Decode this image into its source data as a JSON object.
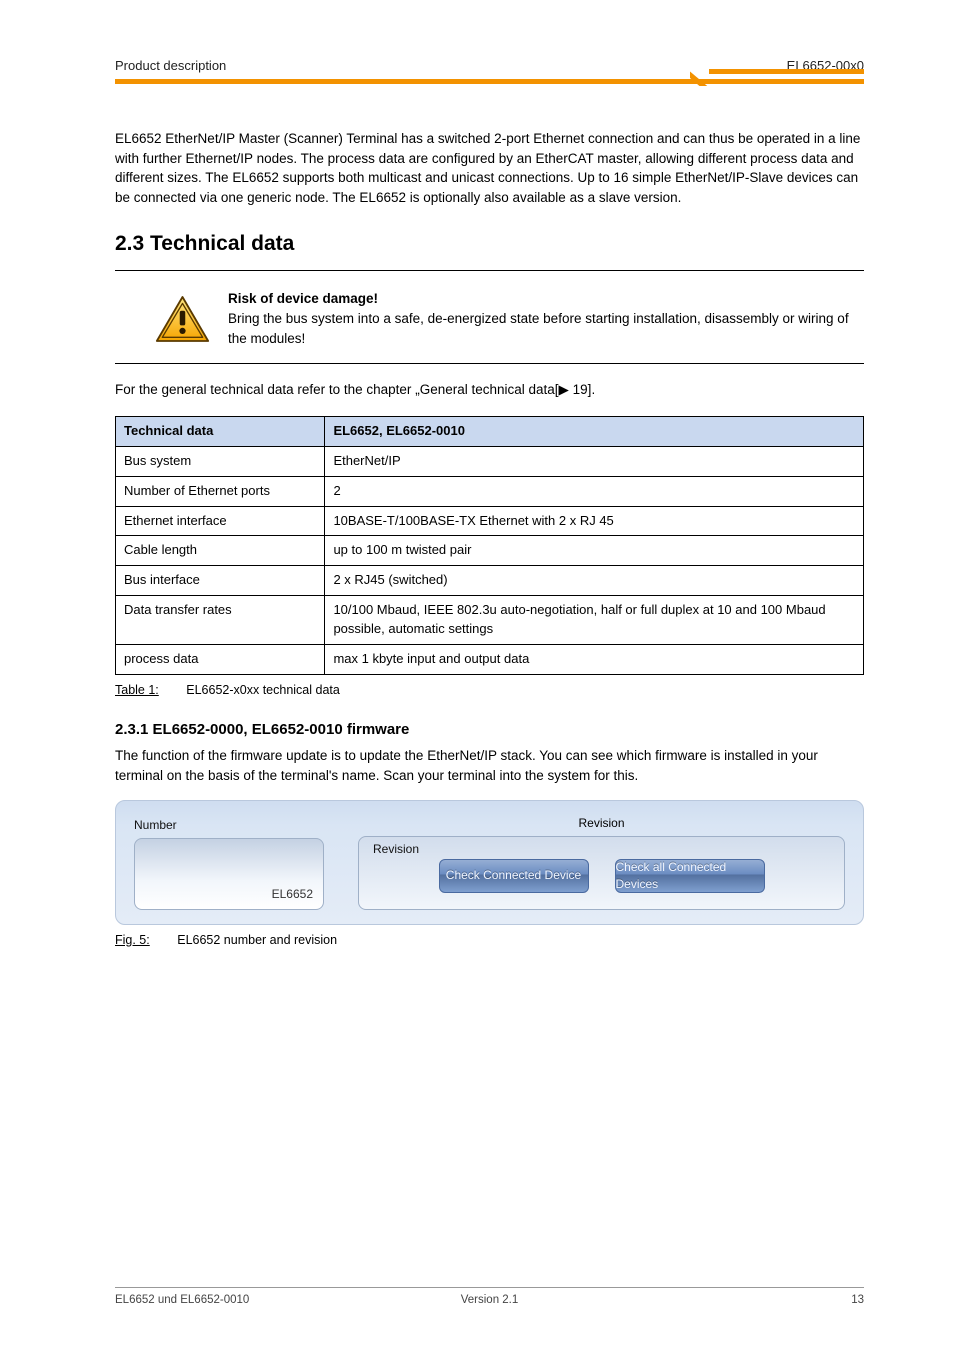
{
  "header": {
    "left": "Product description",
    "right": "EL6652-00x0"
  },
  "p1": "EL6652 EtherNet/IP Master (Scanner) Terminal has a switched 2-port Ethernet connection and can thus be operated in a line with further Ethernet/IP nodes. The process data are configured by an EtherCAT master, allowing different process data and different sizes. The EL6652 supports both multicast and unicast connections. Up to 16 simple EtherNet/IP-Slave devices can be connected via one generic node. The EL6652 is optionally also available as a slave version.",
  "section": "2.3    Technical data",
  "spec_header": {
    "c1": "Technical data",
    "c2": "EL6652, EL6652-0010"
  },
  "spec": [
    {
      "k": "Bus system",
      "v": "EtherNet/IP"
    },
    {
      "k": "Number of Ethernet ports",
      "v": "2"
    },
    {
      "k": "Ethernet interface",
      "v": "10BASE-T/100BASE-TX Ethernet with 2 x RJ 45"
    },
    {
      "k": "Cable length",
      "v": "up to 100 m twisted pair"
    },
    {
      "k": "Bus interface",
      "v": "2 x RJ45 (switched)"
    },
    {
      "k": "Data transfer rates",
      "v": "10/100 Mbaud, IEEE 802.3u auto-negotiation, half or full duplex at 10 and 100 Mbaud possible, automatic settings"
    },
    {
      "k": "process data",
      "v": "max 1 kbyte input and output data"
    }
  ],
  "general": {
    "header": "For the general technical data refer to the chapter",
    "link": "„General technical data[▶ 19]"
  },
  "cap1": {
    "label": "Table 1:",
    "text": "EL6652-x0xx technical data"
  },
  "warn_title": "Risk of device damage!",
  "warn_body": "Bring the bus system into a safe, de-energized state before starting installation, disassembly or wiring of the modules!",
  "subh": "2.3.1     EL6652-0000, EL6652-0010 firmware",
  "p2": "The function of the firmware update is to update the EtherNet/IP stack. You can see which firmware is installed in your terminal on the basis of the terminal's name. Scan your terminal into the system for this.",
  "gui": {
    "input_label": "Number",
    "input_value": "EL6652",
    "frame_label_top": "Revision",
    "revision_label": "Revision",
    "btn1": "Check Connected Device",
    "btn2": "Check all Connected Devices"
  },
  "cap2": {
    "label": "Fig. 5:",
    "text": "EL6652 number and revision"
  },
  "footer": {
    "l": "EL6652 und EL6652-0010",
    "c": "Version 2.1",
    "r": "13"
  }
}
